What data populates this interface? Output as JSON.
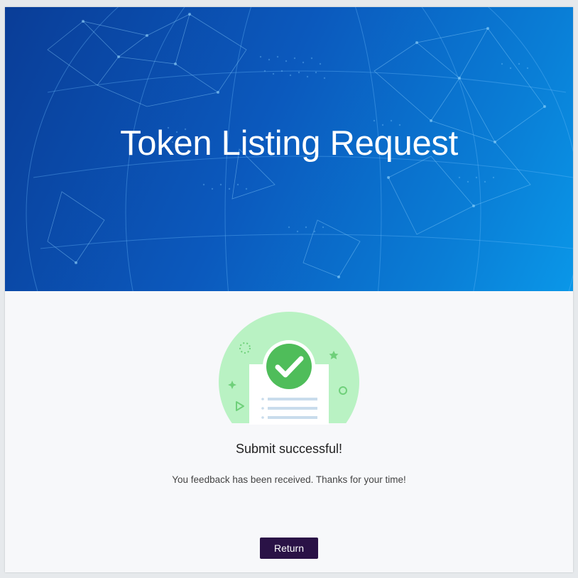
{
  "header": {
    "title": "Token Listing Request"
  },
  "result": {
    "title": "Submit successful!",
    "message": "You feedback has been received. Thanks for your time!",
    "icon": "check-icon",
    "status_color": "#4fbd5a"
  },
  "actions": {
    "return_label": "Return",
    "button_color": "#2a1246"
  },
  "theme": {
    "hero_gradient_start": "#0a3d97",
    "hero_gradient_end": "#0a97e8",
    "page_background": "#f7f8fa"
  }
}
